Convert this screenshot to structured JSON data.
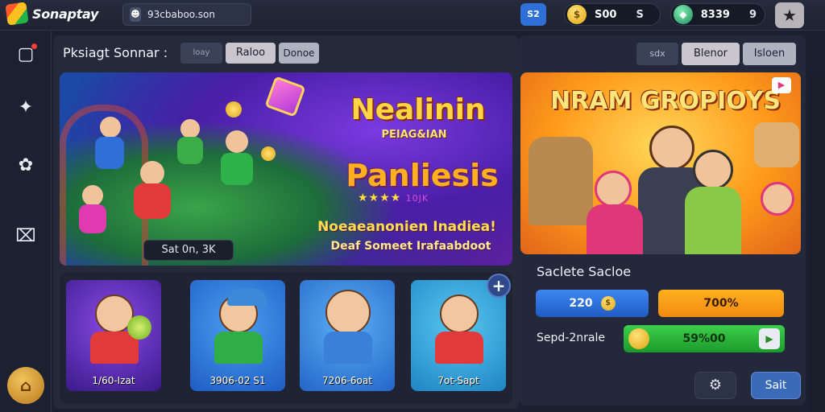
{
  "app": {
    "name": "Sonaptay"
  },
  "search": {
    "value": "93cbaboo.son"
  },
  "header": {
    "badge": "S2",
    "coins": {
      "value": "S00",
      "extra": "S"
    },
    "gems": {
      "value": "8339",
      "extra": "9"
    }
  },
  "main": {
    "title": "Pksiagt Sonnar :",
    "tabs": [
      "loay",
      "Raloo",
      "Donoe"
    ]
  },
  "banner": {
    "title": "Nealinin",
    "subtitle": "PEIAG&IAN",
    "name": "Panliesis",
    "stars_tag": "10JK",
    "line1": "Noeaeanonien Inadiea!",
    "line2": "Deaf Someet Irafaabdoot",
    "pill": "Sat 0n, 3K"
  },
  "cards": [
    {
      "label": "1/60-Izat",
      "bg": "#5b2bb0"
    },
    {
      "label": "3906-02 S1",
      "bg": "#2a7ad8"
    },
    {
      "label": "7206-6oat",
      "bg": "#2f78d0"
    },
    {
      "label": "7ot-Sapt",
      "bg": "#2aa0d8"
    }
  ],
  "right": {
    "tabs": [
      "sdx",
      "Blenor",
      "Isloen"
    ],
    "promo_title": "NRAM GROPIOYS",
    "label1": "Saclete Sacloe",
    "buy_value": "220",
    "orange_value": "700%",
    "label2": "Sepd-2nrale",
    "green_value": "59%00",
    "save_label": "Sait"
  },
  "colors": {
    "accent_blue": "#2f6fd8",
    "accent_orange": "#f28a10",
    "accent_green": "#1c9a2c",
    "bg": "#1b1f2e"
  }
}
